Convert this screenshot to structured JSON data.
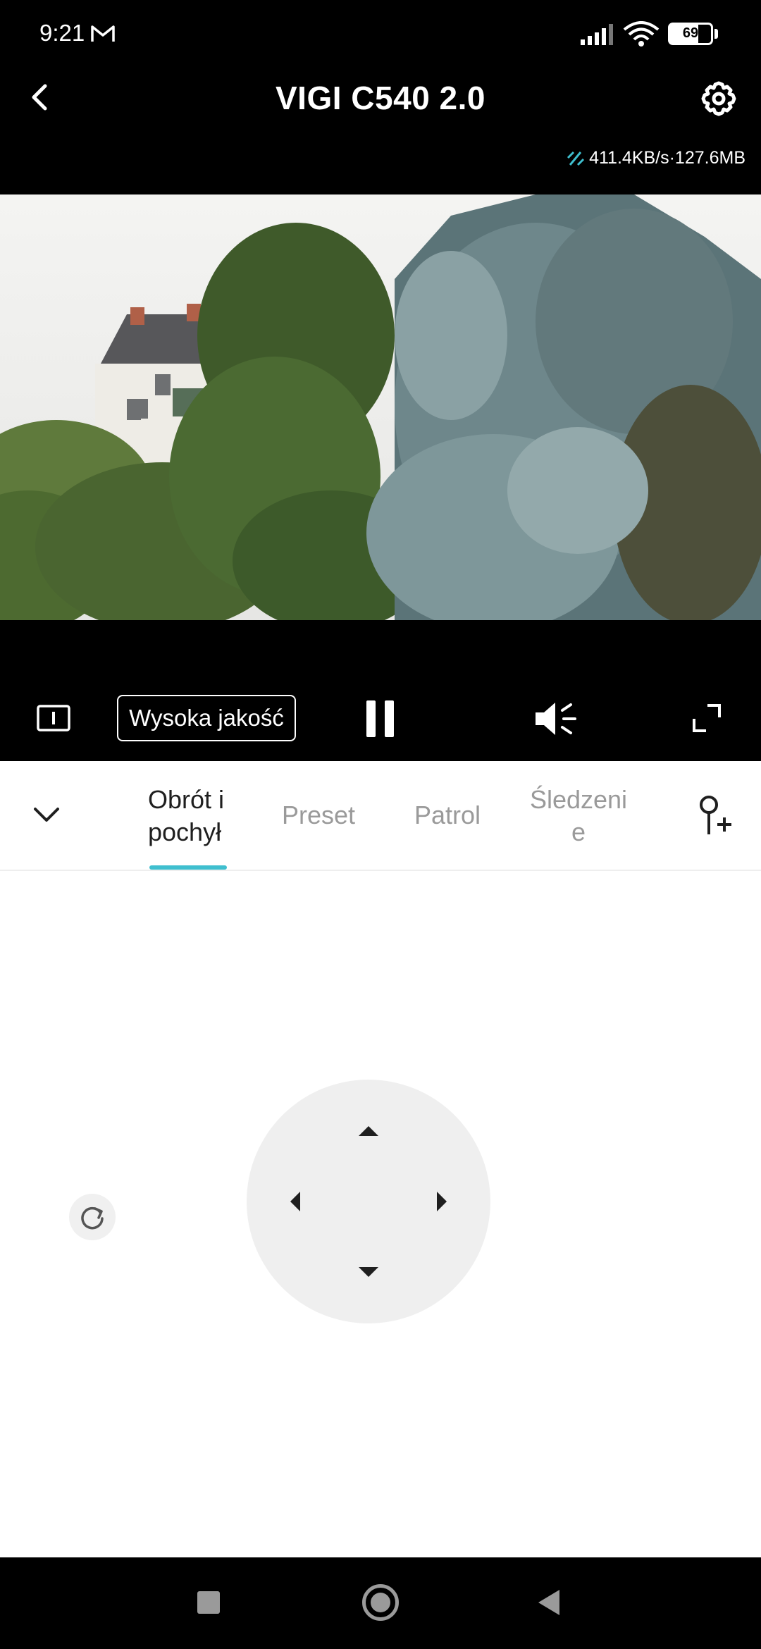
{
  "status_bar": {
    "time": "9:21",
    "battery": "69",
    "battery_level": 0.69,
    "icons": [
      "gmail-icon",
      "signal-icon",
      "wifi-icon",
      "battery-icon"
    ]
  },
  "header": {
    "title": "VIGI C540 2.0",
    "back_icon": "chevron-left-icon",
    "settings_icon": "gear-icon",
    "bandwidth": "411.4KB/s·127.6MB"
  },
  "video": {
    "content": "live camera feed"
  },
  "player_controls": {
    "quality_label": "Wysoka jakość",
    "icons": [
      "info-box-icon",
      "pause-icon",
      "speaker-icon",
      "fullscreen-icon"
    ]
  },
  "tabs": {
    "items": [
      {
        "label_line1": "Obrót i",
        "label_line2": "pochył",
        "active": true
      },
      {
        "label": "Preset",
        "active": false
      },
      {
        "label": "Patrol",
        "active": false
      },
      {
        "label_line1": "Śledzeni",
        "label_line2": "e",
        "active": false
      }
    ],
    "accent_color": "#3fbfcf"
  },
  "ptz": {
    "icons": [
      "reset-icon",
      "arrow-up-icon",
      "arrow-down-icon",
      "arrow-left-icon",
      "arrow-right-icon"
    ]
  },
  "colors": {
    "bar_background": "#000000",
    "joystick_background": "#efefef",
    "inactive_tab": "#9a9a9a",
    "active_tab": "#1f1f1f"
  }
}
